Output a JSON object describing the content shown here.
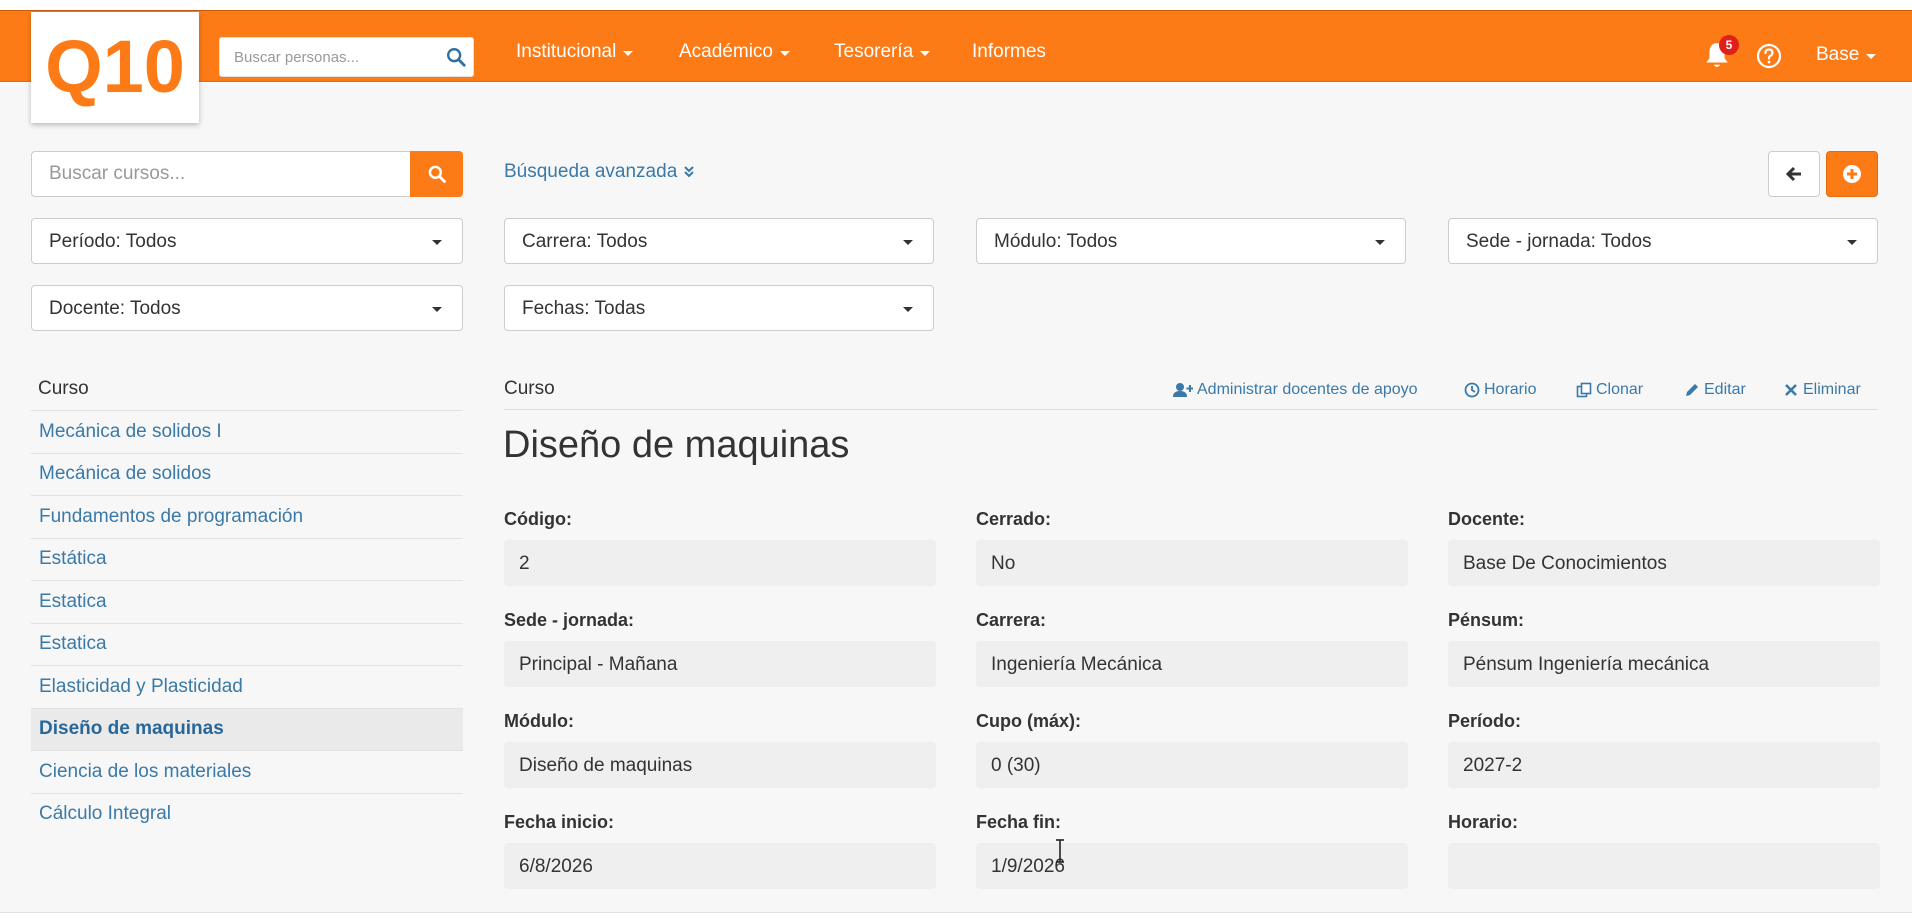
{
  "header": {
    "logo_text": "Q10",
    "people_search": {
      "placeholder": "Buscar personas..."
    },
    "nav": [
      "Institucional",
      "Académico",
      "Tesorería",
      "Informes"
    ],
    "notifications_count": "5",
    "user": "Base",
    "brand_color": "#fd7b16"
  },
  "toolbar": {
    "course_search": {
      "placeholder": "Buscar cursos..."
    },
    "advanced_search": "Búsqueda avanzada"
  },
  "filters": [
    {
      "id": "periodo",
      "label": "Período: Todos"
    },
    {
      "id": "carrera",
      "label": "Carrera: Todos"
    },
    {
      "id": "modulo",
      "label": "Módulo: Todos"
    },
    {
      "id": "sede-jornada",
      "label": "Sede - jornada: Todos"
    },
    {
      "id": "docente",
      "label": "Docente: Todos"
    },
    {
      "id": "fechas",
      "label": "Fechas: Todas"
    }
  ],
  "course_list": {
    "header": "Curso",
    "items": [
      "Mecánica de solidos I",
      "Mecánica de solidos",
      "Fundamentos de programación",
      "Estática",
      "Estatica",
      "Estatica",
      "Elasticidad y Plasticidad",
      "Diseño de maquinas",
      "Ciencia de los materiales",
      "Cálculo Integral"
    ],
    "active_index": 7
  },
  "detail": {
    "header": "Curso",
    "actions": [
      "Administrar docentes de apoyo",
      "Horario",
      "Clonar",
      "Editar",
      "Eliminar"
    ],
    "title": "Diseño de maquinas",
    "fields": [
      {
        "label": "Código:",
        "value": "2"
      },
      {
        "label": "Cerrado:",
        "value": "No"
      },
      {
        "label": "Docente:",
        "value": "Base De Conocimientos"
      },
      {
        "label": "Sede - jornada:",
        "value": "Principal - Mañana"
      },
      {
        "label": "Carrera:",
        "value": "Ingeniería Mecánica"
      },
      {
        "label": "Pénsum:",
        "value": "Pénsum Ingeniería mecánica"
      },
      {
        "label": "Módulo:",
        "value": "Diseño de maquinas"
      },
      {
        "label": "Cupo (máx):",
        "value": "0 (30)"
      },
      {
        "label": "Período:",
        "value": "2027-2"
      },
      {
        "label": "Fecha inicio:",
        "value": "6/8/2026"
      },
      {
        "label": "Fecha fin:",
        "value": "1/9/2026"
      },
      {
        "label": "Horario:",
        "value": ""
      }
    ]
  }
}
